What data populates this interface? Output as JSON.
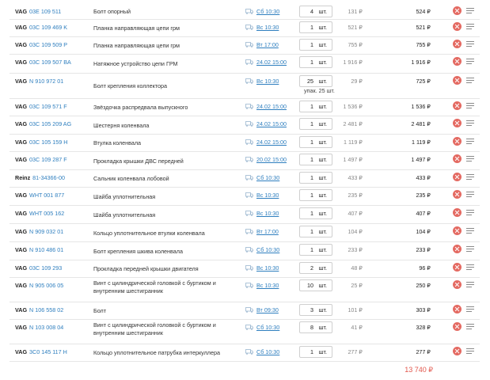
{
  "cart": {
    "rows": [
      {
        "brand": "VAG",
        "article": "03E 109 511",
        "name": "Болт опорный",
        "delivery": "Сб 10:30",
        "qty": "4",
        "unit": "шт.",
        "pack": "",
        "price": "131 ₽",
        "sum": "524 ₽"
      },
      {
        "brand": "VAG",
        "article": "03C 109 469 K",
        "name": "Планка направляющая цепи грм",
        "delivery": "Вс 10:30",
        "qty": "1",
        "unit": "шт.",
        "pack": "",
        "price": "521 ₽",
        "sum": "521 ₽"
      },
      {
        "brand": "VAG",
        "article": "03C 109 509 P",
        "name": "Планка направляющая цепи грм",
        "delivery": "Вт 17:00",
        "qty": "1",
        "unit": "шт.",
        "pack": "",
        "price": "755 ₽",
        "sum": "755 ₽"
      },
      {
        "brand": "VAG",
        "article": "03C 109 507 BA",
        "name": "Натяжное устройство цепи ГРМ",
        "delivery": "24.02 15:00",
        "qty": "1",
        "unit": "шт.",
        "pack": "",
        "price": "1 916 ₽",
        "sum": "1 916 ₽"
      },
      {
        "brand": "VAG",
        "article": "N 910 972 01",
        "name": "Болт крепления коллектора",
        "delivery": "Вс 10:30",
        "qty": "25",
        "unit": "шт.",
        "pack": "упак. 25 шт.",
        "price": "29 ₽",
        "sum": "725 ₽"
      },
      {
        "brand": "VAG",
        "article": "03C 109 571 F",
        "name": "Звёздочка распредвала выпускного",
        "delivery": "24.02 15:00",
        "qty": "1",
        "unit": "шт.",
        "pack": "",
        "price": "1 536 ₽",
        "sum": "1 536 ₽"
      },
      {
        "brand": "VAG",
        "article": "03C 105 209 AG",
        "name": "Шестерня коленвала",
        "delivery": "24.02 15:00",
        "qty": "1",
        "unit": "шт.",
        "pack": "",
        "price": "2 481 ₽",
        "sum": "2 481 ₽"
      },
      {
        "brand": "VAG",
        "article": "03C 105 159 H",
        "name": "Втулка коленвала",
        "delivery": "24.02 15:00",
        "qty": "1",
        "unit": "шт.",
        "pack": "",
        "price": "1 119 ₽",
        "sum": "1 119 ₽"
      },
      {
        "brand": "VAG",
        "article": "03C 109 287 F",
        "name": "Прокладка крышки ДВС передней",
        "delivery": "20.02 15:00",
        "qty": "1",
        "unit": "шт.",
        "pack": "",
        "price": "1 497 ₽",
        "sum": "1 497 ₽"
      },
      {
        "brand": "Reinz",
        "article": "81-34366-00",
        "name": "Сальник коленвала лобовой",
        "delivery": "Сб 10:30",
        "qty": "1",
        "unit": "шт.",
        "pack": "",
        "price": "433 ₽",
        "sum": "433 ₽"
      },
      {
        "brand": "VAG",
        "article": "WHT 001 877",
        "name": "Шайба уплотнительная",
        "delivery": "Вс 10:30",
        "qty": "1",
        "unit": "шт.",
        "pack": "",
        "price": "235 ₽",
        "sum": "235 ₽"
      },
      {
        "brand": "VAG",
        "article": "WHT 005 162",
        "name": "Шайба уплотнительная",
        "delivery": "Вс 10:30",
        "qty": "1",
        "unit": "шт.",
        "pack": "",
        "price": "407 ₽",
        "sum": "407 ₽"
      },
      {
        "brand": "VAG",
        "article": "N 909 032 01",
        "name": "Кольцо уплотнительное втулки коленвала",
        "delivery": "Вт 17:00",
        "qty": "1",
        "unit": "шт.",
        "pack": "",
        "price": "104 ₽",
        "sum": "104 ₽"
      },
      {
        "brand": "VAG",
        "article": "N 910 486 01",
        "name": "Болт крепления шкива коленвала",
        "delivery": "Сб 10:30",
        "qty": "1",
        "unit": "шт.",
        "pack": "",
        "price": "233 ₽",
        "sum": "233 ₽"
      },
      {
        "brand": "VAG",
        "article": "03C 109 293",
        "name": "Прокладка передней крышки двигателя",
        "delivery": "Вс 10:30",
        "qty": "2",
        "unit": "шт.",
        "pack": "",
        "price": "48 ₽",
        "sum": "96 ₽"
      },
      {
        "brand": "VAG",
        "article": "N 905 006 05",
        "name": "Винт с цилиндрической головкой с буртиком и внутренним шестигранник",
        "delivery": "Вс 10:30",
        "qty": "10",
        "unit": "шт.",
        "pack": "",
        "price": "25 ₽",
        "sum": "250 ₽"
      },
      {
        "brand": "VAG",
        "article": "N 106 558 02",
        "name": "Болт",
        "delivery": "Вт 09:30",
        "qty": "3",
        "unit": "шт.",
        "pack": "",
        "price": "101 ₽",
        "sum": "303 ₽"
      },
      {
        "brand": "VAG",
        "article": "N 103 008 04",
        "name": "Винт с цилиндрической головкой с буртиком и внутренним шестигранник",
        "delivery": "Сб 10:30",
        "qty": "8",
        "unit": "шт.",
        "pack": "",
        "price": "41 ₽",
        "sum": "328 ₽"
      },
      {
        "brand": "VAG",
        "article": "3C0 145 117 H",
        "name": "Кольцо уплотнительное патрубка интеркуллера",
        "delivery": "Сб 10:30",
        "qty": "1",
        "unit": "шт.",
        "pack": "",
        "price": "277 ₽",
        "sum": "277 ₽"
      }
    ],
    "total": "13 740 ₽"
  },
  "colors": {
    "link": "#2f7fbf",
    "delete": "#e46a62",
    "total": "#e2574c"
  },
  "icons": {
    "delivery": "truck-icon",
    "remove": "close-circle-icon",
    "menu": "menu-lines-icon"
  }
}
